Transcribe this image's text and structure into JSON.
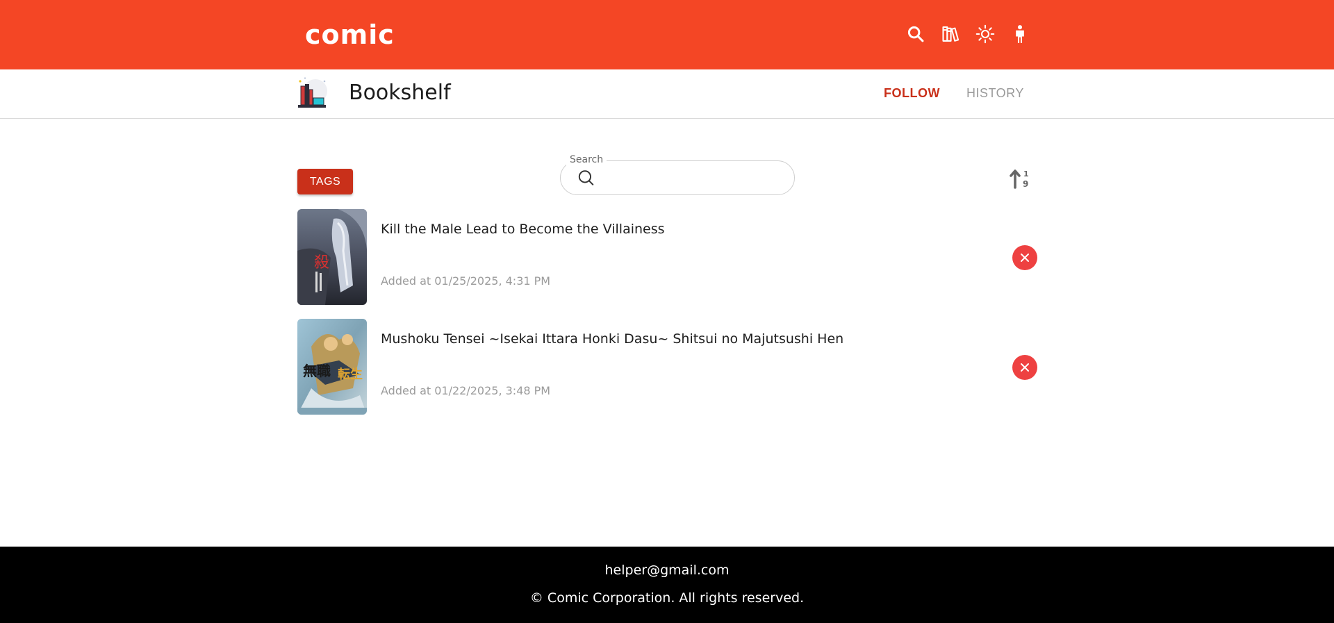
{
  "header": {
    "logo": "comic",
    "icons": [
      "search-icon",
      "bookshelf-icon",
      "theme-sun-icon",
      "user-icon"
    ],
    "brand_color": "#f44625"
  },
  "subheader": {
    "title": "Bookshelf",
    "tabs": [
      {
        "label": "FOLLOW",
        "active": true
      },
      {
        "label": "HISTORY",
        "active": false
      }
    ]
  },
  "controls": {
    "tags_label": "TAGS",
    "search_label": "Search",
    "search_value": "",
    "sort_icon": "sort-numeric-ascending-icon"
  },
  "items": [
    {
      "title": "Kill the Male Lead to Become the Villainess",
      "date": "Added at 01/25/2025, 4:31 PM"
    },
    {
      "title": "Mushoku Tensei ~Isekai Ittara Honki Dasu~ Shitsui no Majutsushi Hen",
      "date": "Added at 01/22/2025, 3:48 PM"
    }
  ],
  "footer": {
    "email": "helper@gmail.com",
    "copyright": "© Comic Corporation. All rights reserved."
  },
  "colors": {
    "accent": "#c9301a",
    "remove": "#ee4141",
    "footer": "#000000"
  }
}
